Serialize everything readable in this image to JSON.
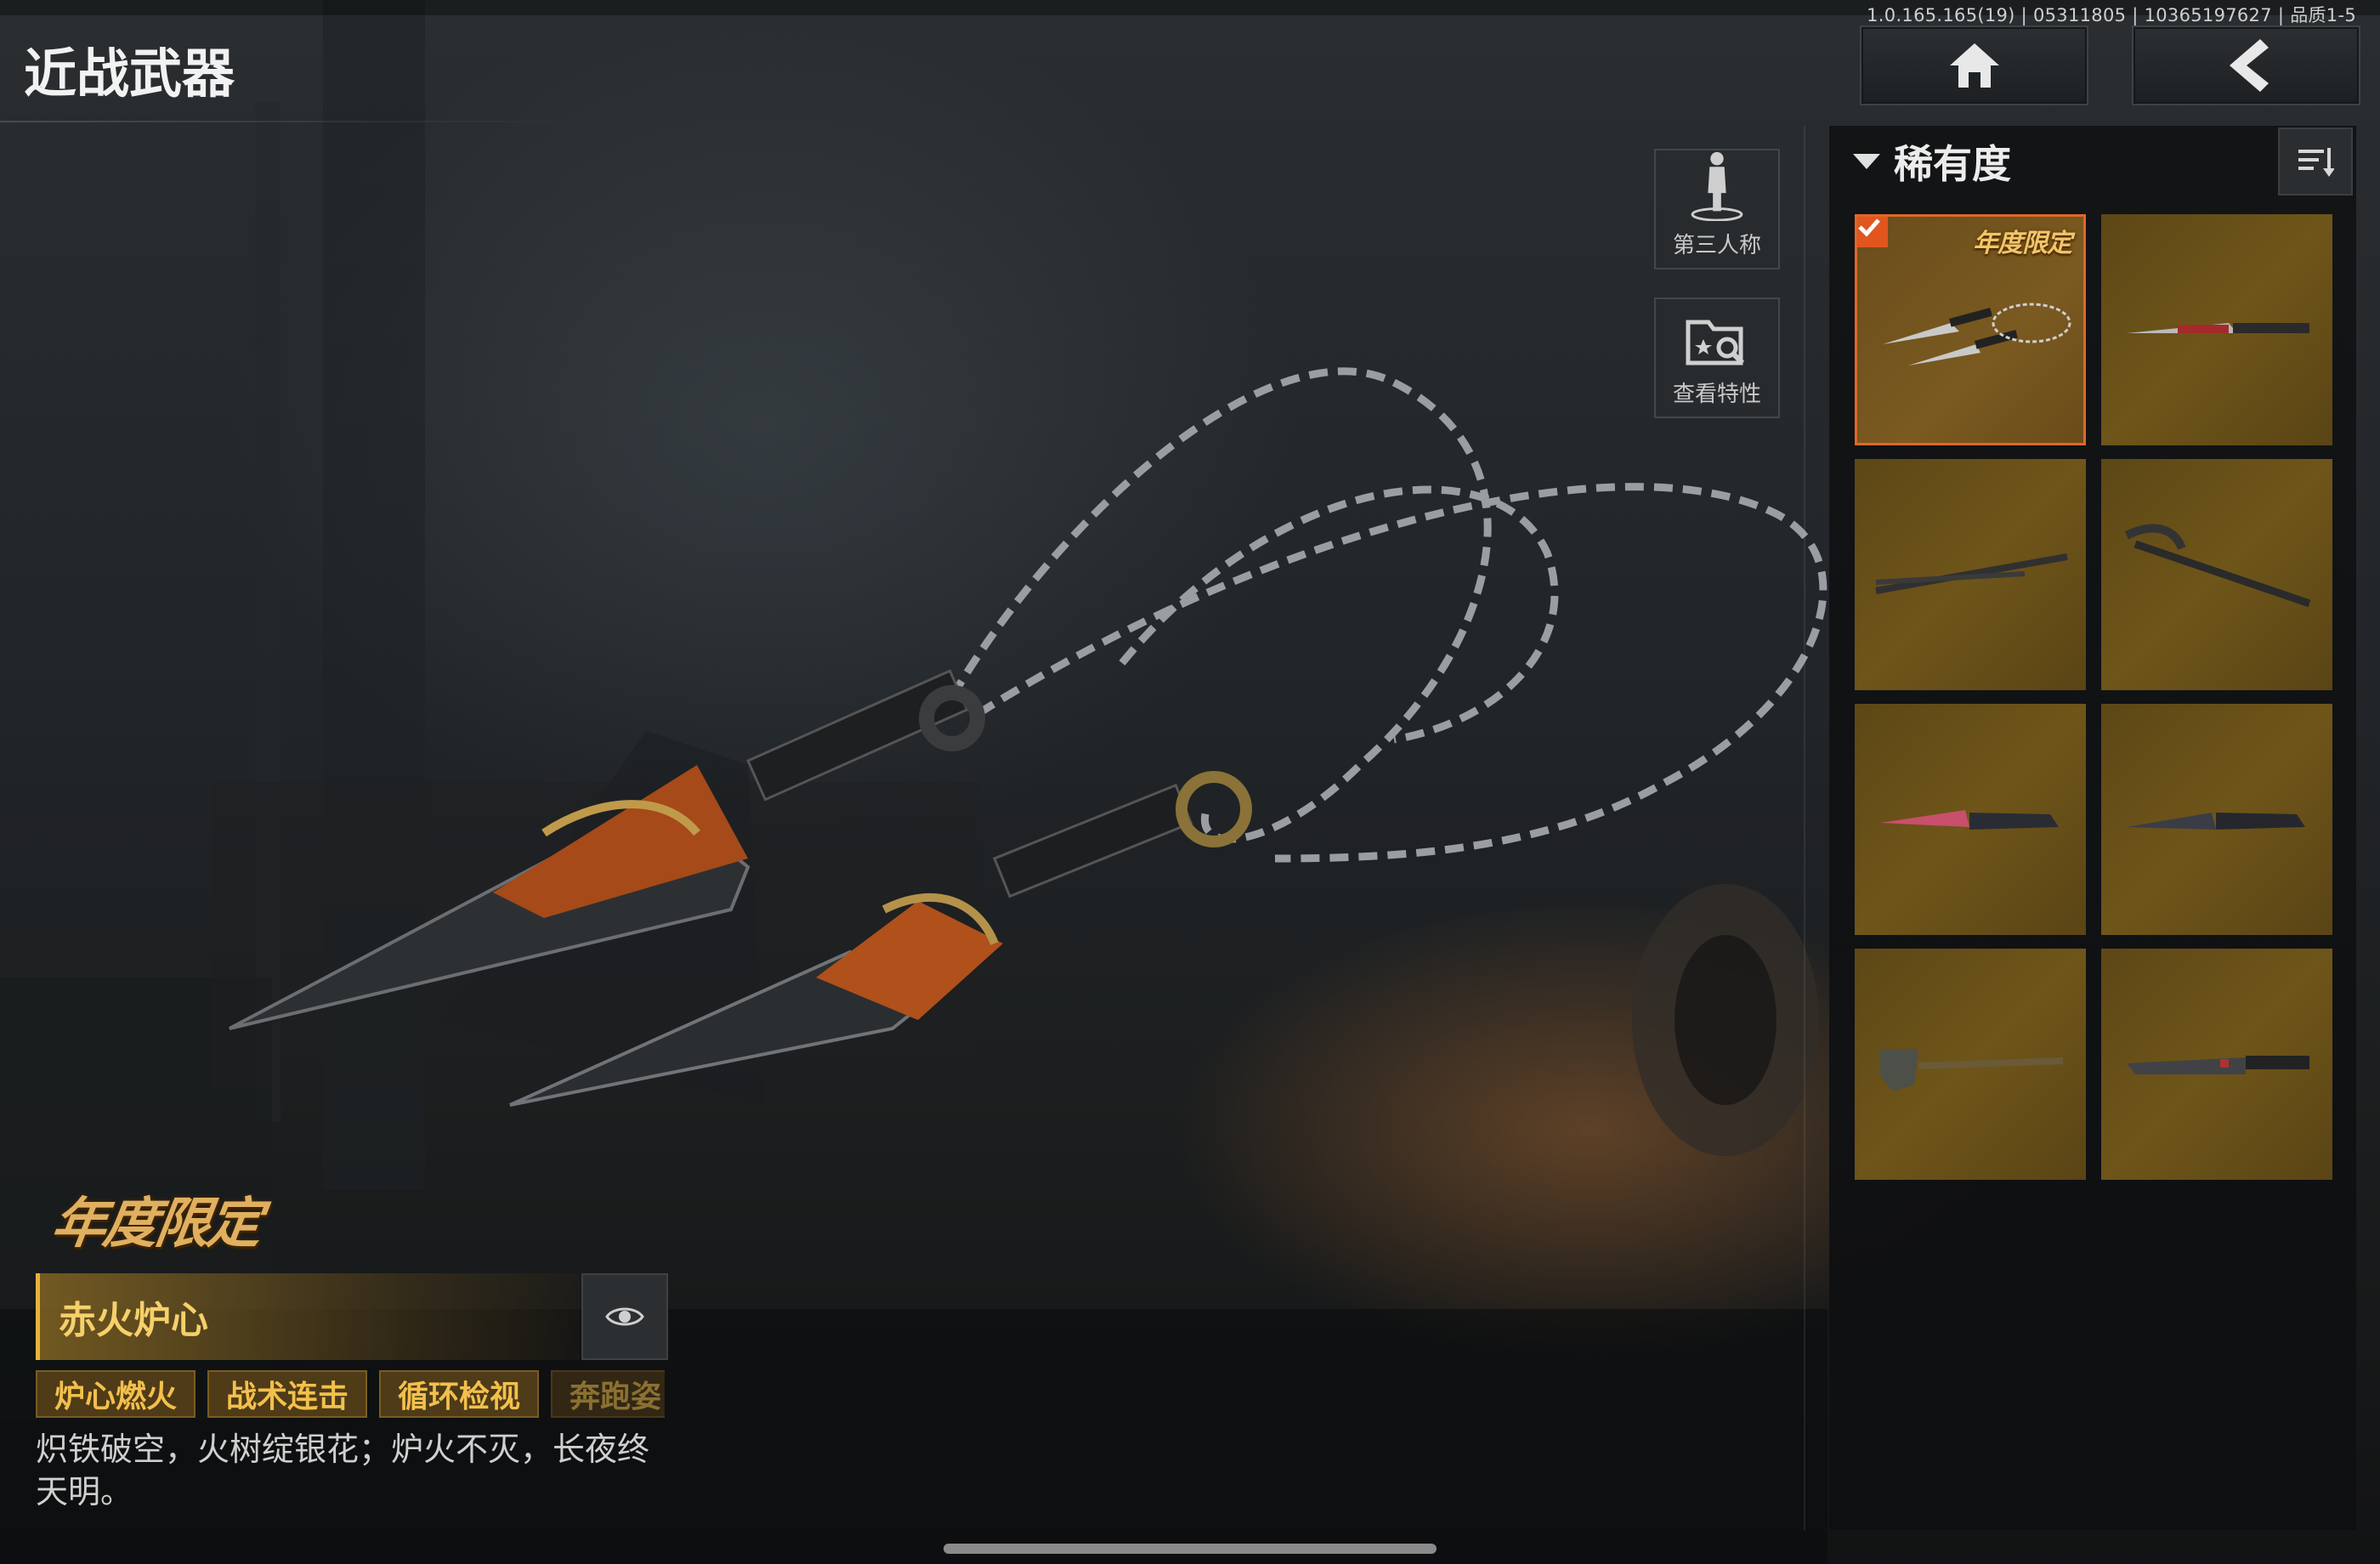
{
  "app": {
    "version_info": "1.0.165.165(19) | 05311805 | 10365197627 | 品质1-5",
    "page_title": "近战武器"
  },
  "nav": {
    "home_icon": "home-icon",
    "back_icon": "chevron-left-icon"
  },
  "side_buttons": {
    "third_person_label": "第三人称",
    "view_features_label": "查看特性"
  },
  "inventory": {
    "filter_label": "稀有度",
    "sort_icon": "sort-icon",
    "items": [
      {
        "kind": "kunai-chain",
        "selected": true,
        "tag": "年度限定"
      },
      {
        "kind": "red-blade",
        "selected": false
      },
      {
        "kind": "katana",
        "selected": false
      },
      {
        "kind": "pickaxe",
        "selected": false
      },
      {
        "kind": "pink-knife",
        "selected": false
      },
      {
        "kind": "dark-knife",
        "selected": false
      },
      {
        "kind": "shovel",
        "selected": false
      },
      {
        "kind": "machete",
        "selected": false
      }
    ]
  },
  "detail": {
    "limited_badge": "年度限定",
    "name": "赤火炉心",
    "tags": [
      "炉心燃火",
      "战术连击",
      "循环检视",
      "奔跑姿"
    ],
    "description_line1": "炽铁破空，火树绽银花；炉火不灭，长夜终",
    "description_line2": "天明。"
  },
  "colors": {
    "accent_gold": "#f2c04c",
    "selected_border": "#e0672a",
    "tile_bg": "#6e5519",
    "panel_bg": "#101214"
  }
}
